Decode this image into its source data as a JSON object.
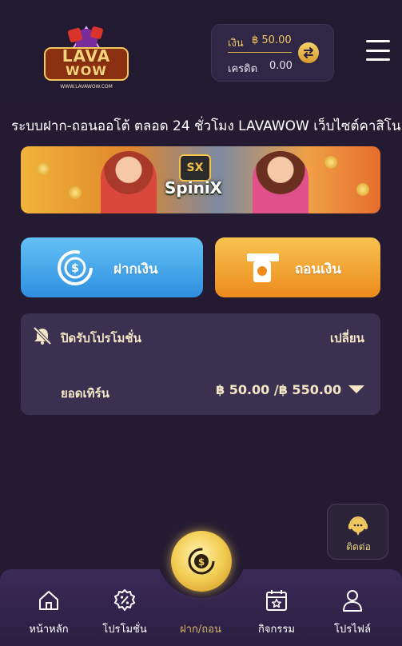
{
  "logo": {
    "line1": "LAVA",
    "line2": "WOW",
    "url": "WWW.LAVAWOW.COM"
  },
  "wallet": {
    "balance_label": "เงิน",
    "balance_value": "฿ 50.00",
    "credit_label": "เครดิต",
    "credit_value": "0.00",
    "swap_icon": "swap-arrows-icon"
  },
  "menu_icon": "hamburger-menu-icon",
  "marquee": {
    "text": "ระบบฝาก-ถอนออโต้ ตลอด 24 ชั่วโมง    LAVAWOW เว็บไซต์คาสิโน"
  },
  "banner": {
    "brand": "SpiniX",
    "emblem": "SX"
  },
  "actions": {
    "deposit_label": "ฝากเงิน",
    "withdraw_label": "ถอนเงิน"
  },
  "promo": {
    "title": "ปิดรับโปรโมชั่น",
    "change_label": "เปลี่ยน",
    "turnover_label": "ยอดเทิร์น",
    "turnover_value": "฿ 50.00 /฿ 550.00"
  },
  "contact": {
    "label": "ติดต่อ"
  },
  "nav": {
    "items": [
      {
        "label": "หน้าหลัก",
        "icon": "home-icon"
      },
      {
        "label": "โปรโมชั่น",
        "icon": "promotion-badge-icon"
      },
      {
        "label": "ฝาก/ถอน",
        "icon": "deposit-withdraw-icon"
      },
      {
        "label": "กิจกรรม",
        "icon": "calendar-star-icon"
      },
      {
        "label": "โปรไฟล์",
        "icon": "user-icon"
      }
    ]
  },
  "colors": {
    "background": "#241b33",
    "accent_gold": "#f0c860",
    "deposit_blue": "#2e8fe0",
    "withdraw_orange": "#ed8b1d"
  }
}
